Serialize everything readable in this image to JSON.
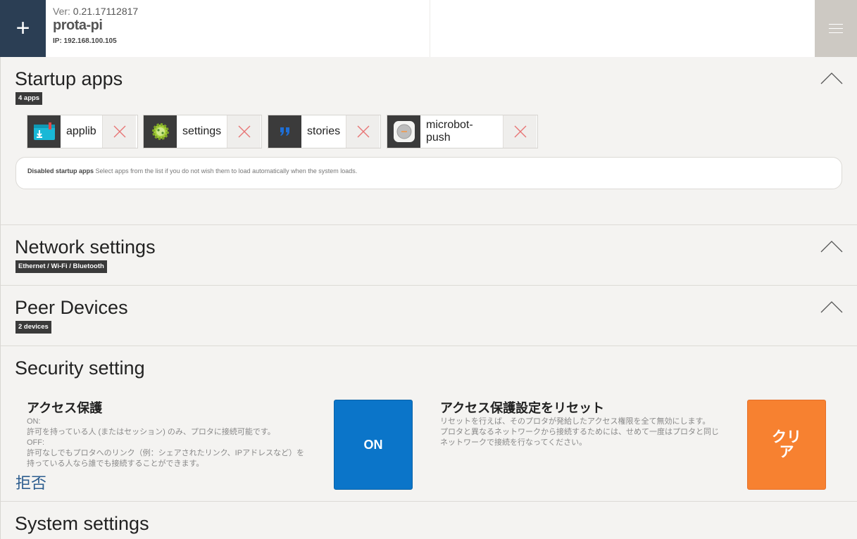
{
  "header": {
    "add_label": "+",
    "ver_label": "Ver:",
    "ver_value": "0.21.17112817",
    "host": "prota-pi",
    "ip": "IP: 192.168.100.105"
  },
  "startup": {
    "title": "Startup apps",
    "badge": "4 apps",
    "apps": [
      {
        "name": "applib"
      },
      {
        "name": "settings"
      },
      {
        "name": "stories"
      },
      {
        "name": "microbot-push"
      }
    ],
    "disabled_label": "Disabled startup apps",
    "disabled_desc": "Select apps from the list if you do not wish them to load automatically when the system loads."
  },
  "network": {
    "title": "Network settings",
    "badge": "Ethernet / Wi-Fi / Bluetooth"
  },
  "peer": {
    "title": "Peer Devices",
    "badge": "2 devices"
  },
  "security": {
    "title": "Security setting",
    "access": {
      "title": "アクセス保護",
      "on_label": "ON:",
      "on_desc": "許可を持っている人 (またはセッション) のみ、プロタに接続可能です。",
      "off_label": "OFF:",
      "off_desc_1": "許可なしでもプロタへのリンク（例：シェアされたリンク、IPアドレスなど）を",
      "off_desc_2": "持っている人なら誰でも接続することができます。",
      "deny": "拒否",
      "button": "ON"
    },
    "reset": {
      "title": "アクセス保護設定をリセット",
      "desc_1": "リセットを行えば、そのプロタが発給したアクセス権限を全て無効にします。",
      "desc_2": "プロタと異なるネットワークから接続するためには、せめて一度はプロタと同じ",
      "desc_3": "ネットワークで接続を行なってください。",
      "button_line1": "クリ",
      "button_line2": "ア"
    }
  },
  "system": {
    "title": "System settings"
  },
  "colors": {
    "header_dark": "#2b3e54",
    "menu_bg": "#cdc9c3",
    "on_button": "#0b75c9",
    "clear_button": "#f78130",
    "remove_x": "#e87575"
  }
}
